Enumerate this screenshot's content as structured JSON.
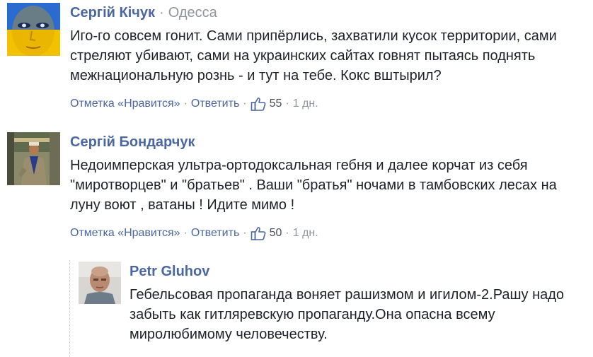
{
  "comments": [
    {
      "author": "Сергій Кічук",
      "location": "Одесса",
      "separator": "·",
      "text": "Иго-го совсем гонит. Сами припёрлись, захватили кусок территории, сами стреляют убивают, сами на украинских сайтах говнят пытаясь поднять межнациональную рознь - и тут на тебе. Кокс вштырил?",
      "like_label": "Отметка «Нравится»",
      "reply_label": "Ответить",
      "likes": "55",
      "time": "1 дн.",
      "avatar_icon": "ukraine-flag-face-avatar"
    },
    {
      "author": "Сергій Бондарчук",
      "text": "Недоимперская ультра-ортодоксальная гебня и далее корчат из себя \"миротворцев\" и \"братьев\" . Ваши \"братья\" ночами в тамбовских лесах на луну воют , ватаны ! Идите мимо !",
      "like_label": "Отметка «Нравится»",
      "reply_label": "Ответить",
      "likes": "50",
      "time": "1 дн.",
      "avatar_icon": "man-outdoors-avatar"
    }
  ],
  "reply": {
    "author": "Petr Gluhov",
    "text": "Гебельсовая пропаганда воняет рашизмом и игилом-2.Рашу надо забыть как гитляревскую пропаганду.Она опасна всему миролюбимому человечеству.",
    "avatar_icon": "bald-man-avatar"
  },
  "ui": {
    "dot": "·",
    "link_color": "#4b67a1",
    "meta_color": "#90949c",
    "text_color": "#1d2129"
  }
}
